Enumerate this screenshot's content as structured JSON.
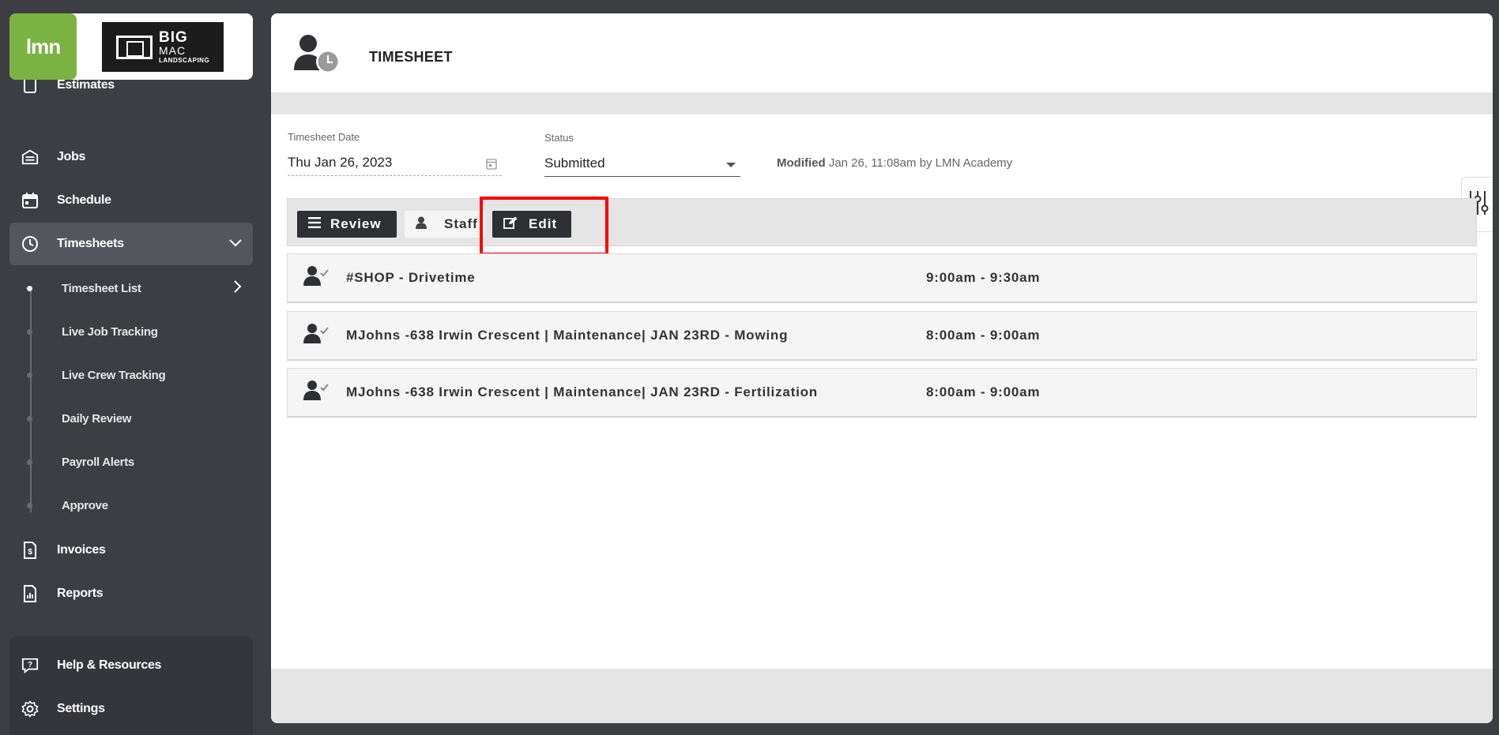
{
  "brand": {
    "app_logo": "lmn",
    "client_logo_big": "BIG",
    "client_logo_big2": "MAC",
    "client_logo_sub": "LANDSCAPING"
  },
  "sidebar": {
    "items": [
      {
        "label": "Estimates",
        "icon": "calculator-icon"
      },
      {
        "label": "Jobs",
        "icon": "jobs-icon"
      },
      {
        "label": "Schedule",
        "icon": "calendar-icon"
      },
      {
        "label": "Timesheets",
        "icon": "clock-icon"
      }
    ],
    "sub_items": [
      {
        "label": "Timesheet List"
      },
      {
        "label": "Live Job Tracking"
      },
      {
        "label": "Live Crew Tracking"
      },
      {
        "label": "Daily Review"
      },
      {
        "label": "Payroll Alerts"
      },
      {
        "label": "Approve"
      }
    ],
    "items_lower": [
      {
        "label": "Invoices",
        "icon": "invoice-icon"
      },
      {
        "label": "Reports",
        "icon": "report-icon"
      }
    ],
    "bottom": [
      {
        "label": "Help & Resources",
        "icon": "help-icon"
      },
      {
        "label": "Settings",
        "icon": "gear-icon"
      }
    ]
  },
  "header": {
    "title": "TIMESHEET"
  },
  "form": {
    "date_label": "Timesheet Date",
    "date_value": "Thu Jan 26, 2023",
    "status_label": "Status",
    "status_value": "Submitted",
    "modified_label": "Modified",
    "modified_text": "Jan 26, 11:08am by LMN Academy"
  },
  "toolbar": {
    "review_label": "Review",
    "staff_label": "Staff",
    "edit_label": "Edit"
  },
  "entries": [
    {
      "name": "#SHOP - Drivetime",
      "time": "9:00am - 9:30am"
    },
    {
      "name": "MJohns -638 Irwin Crescent | Maintenance| JAN 23RD - Mowing",
      "time": "8:00am - 9:00am"
    },
    {
      "name": "MJohns -638 Irwin Crescent | Maintenance| JAN 23RD - Fertilization",
      "time": "8:00am - 9:00am"
    }
  ],
  "colors": {
    "sidebar_bg": "#3d3e44",
    "brand_green": "#7bb342",
    "highlight": "#ff0000",
    "dark_button": "#2f3033"
  }
}
